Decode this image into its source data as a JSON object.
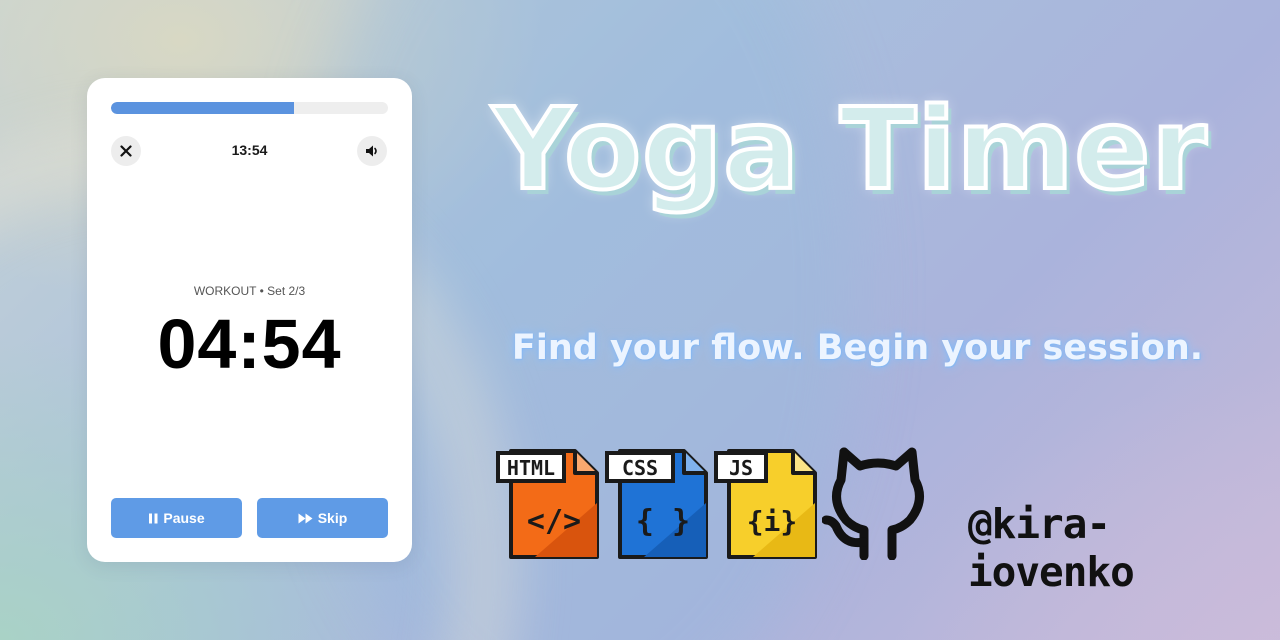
{
  "timer_card": {
    "progress_fraction": 0.66,
    "clock": "13:54",
    "set_label": "WORKOUT • Set 2/3",
    "countdown": "04:54",
    "pause_label": "Pause",
    "skip_label": "Skip",
    "close_icon": "close-icon",
    "sound_icon": "speaker-icon",
    "accent_color": "#5b93df"
  },
  "hero": {
    "title": "Yoga Timer",
    "subtitle": "Find your flow. Begin your session."
  },
  "tech_icons": [
    {
      "name": "html-file-icon",
      "label": "HTML",
      "glyph": "</>",
      "color": "#f36b17"
    },
    {
      "name": "css-file-icon",
      "label": "CSS",
      "glyph": "{ }",
      "color": "#1f73d6"
    },
    {
      "name": "js-file-icon",
      "label": "JS",
      "glyph": "{i}",
      "color": "#f7cf2b"
    }
  ],
  "github_icon": "github-icon",
  "handle": "@kira-iovenko"
}
